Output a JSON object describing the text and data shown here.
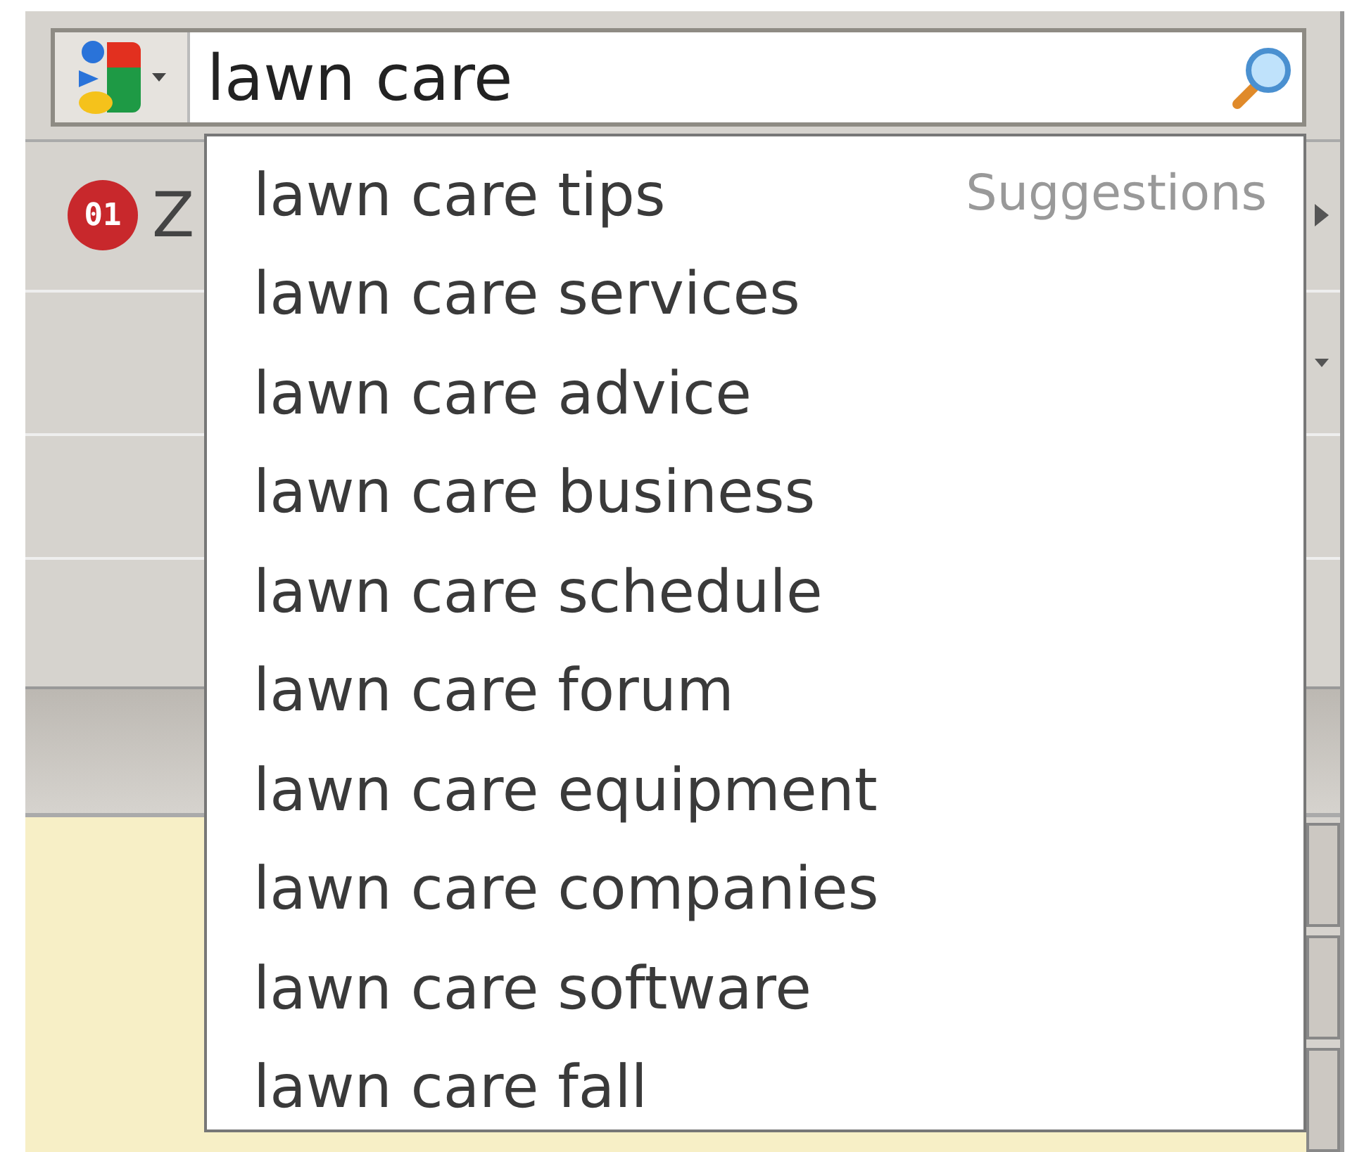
{
  "search_bar": {
    "value": "lawn care"
  },
  "toolbar": {
    "badge": "01",
    "label": "Z"
  },
  "suggestions": {
    "heading": "Suggestions",
    "items": [
      {
        "label": "lawn care tips",
        "selected": false
      },
      {
        "label": "lawn care services",
        "selected": false
      },
      {
        "label": "lawn care advice",
        "selected": false
      },
      {
        "label": "lawn care business",
        "selected": false
      },
      {
        "label": "lawn care schedule",
        "selected": false
      },
      {
        "label": "lawn care forum",
        "selected": false
      },
      {
        "label": "lawn care equipment",
        "selected": false
      },
      {
        "label": "lawn care companies",
        "selected": false
      },
      {
        "label": "lawn care software",
        "selected": false
      },
      {
        "label": "lawn care fall",
        "selected": false
      }
    ]
  }
}
